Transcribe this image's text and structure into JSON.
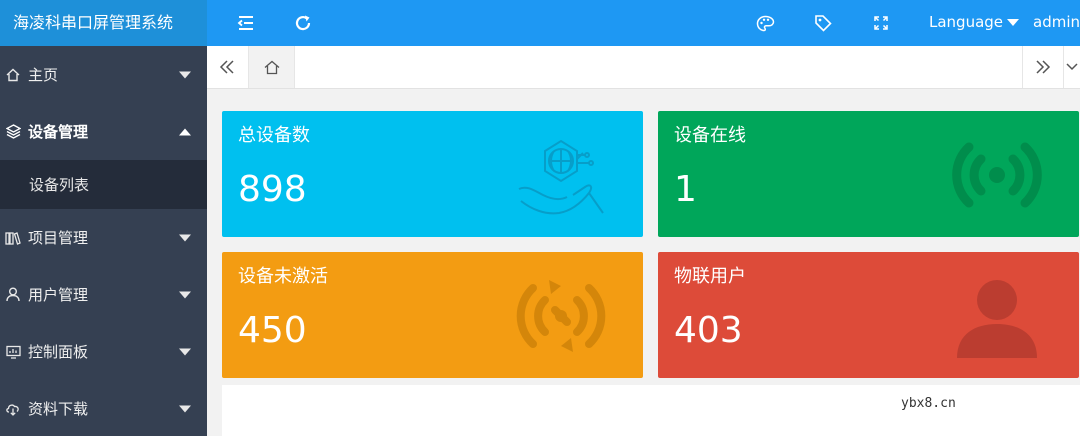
{
  "app": {
    "brand": "海凌科串口屏管理系统"
  },
  "header": {
    "language_label": "Language",
    "user_label": "admin"
  },
  "sidebar": {
    "items": [
      {
        "label": "主页"
      },
      {
        "label": "设备管理",
        "expanded": true,
        "children": [
          {
            "label": "设备列表"
          }
        ]
      },
      {
        "label": "项目管理"
      },
      {
        "label": "用户管理"
      },
      {
        "label": "控制面板"
      },
      {
        "label": "资料下载"
      }
    ]
  },
  "cards": [
    {
      "title": "总设备数",
      "value": "898",
      "color": "#00c0ef",
      "icon": "globe-hand-icon"
    },
    {
      "title": "设备在线",
      "value": "1",
      "color": "#00a65a",
      "icon": "wifi-signal-icon"
    },
    {
      "title": "设备未激活",
      "value": "450",
      "color": "#f39c12",
      "icon": "signal-refresh-icon"
    },
    {
      "title": "物联用户",
      "value": "403",
      "color": "#dd4b39",
      "icon": "user-icon"
    }
  ],
  "watermark": "ybx8.cn",
  "colors": {
    "sidebar_bg": "#354052",
    "brand_bg": "#1e90d9",
    "header_bg": "#1e98f3"
  }
}
